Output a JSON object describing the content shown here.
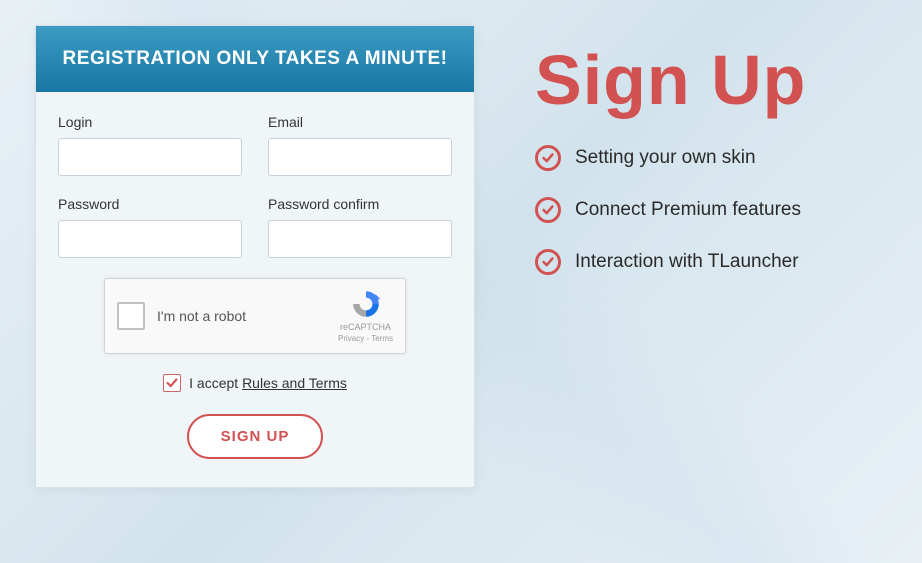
{
  "form": {
    "header": "REGISTRATION ONLY TAKES A MINUTE!",
    "fields": {
      "login_label": "Login",
      "email_label": "Email",
      "password_label": "Password",
      "password_confirm_label": "Password confirm"
    },
    "captcha": {
      "label": "I'm not a robot",
      "brand": "reCAPTCHA",
      "links": "Privacy - Terms"
    },
    "terms": {
      "prefix": "I accept ",
      "link": "Rules and Terms",
      "checked": true
    },
    "submit_label": "SIGN UP"
  },
  "side": {
    "title": "Sign Up",
    "benefits": [
      "Setting your own skin",
      "Connect Premium features",
      "Interaction with TLauncher"
    ]
  },
  "colors": {
    "accent": "#d25252",
    "header_gradient_top": "#3b9bc3",
    "header_gradient_bottom": "#1878a3"
  }
}
